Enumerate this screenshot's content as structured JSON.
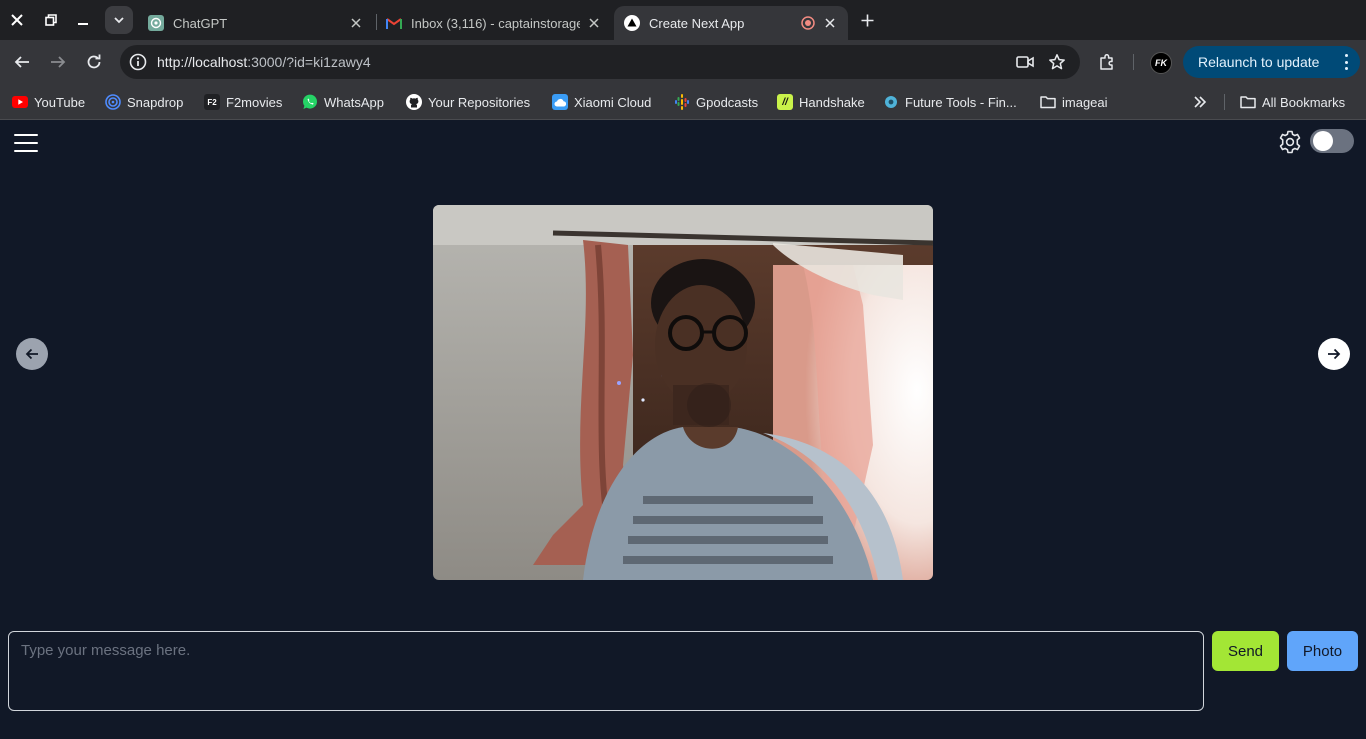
{
  "tabs": [
    {
      "title": "ChatGPT",
      "icon": "chatgpt-icon",
      "active": false
    },
    {
      "title": "Inbox (3,116) - captainstorage",
      "icon": "gmail-icon",
      "active": false
    },
    {
      "title": "Create Next App",
      "icon": "nextjs-icon",
      "active": true,
      "recording": true
    }
  ],
  "toolbar": {
    "url_host": "http://localhost",
    "url_rest": ":3000/?id=ki1zawy4",
    "profile_initials": "FK",
    "relaunch_label": "Relaunch to update"
  },
  "bookmarks": [
    {
      "label": "YouTube",
      "icon": "youtube-icon",
      "color": "#ff0000"
    },
    {
      "label": "Snapdrop",
      "icon": "snapdrop-icon",
      "color": "#4f8cff"
    },
    {
      "label": "F2movies",
      "icon": "f2movies-icon",
      "color": "#ffffff"
    },
    {
      "label": "WhatsApp",
      "icon": "whatsapp-icon",
      "color": "#25d366"
    },
    {
      "label": "Your Repositories",
      "icon": "github-icon",
      "color": "#ffffff"
    },
    {
      "label": "Xiaomi Cloud",
      "icon": "xiaomi-cloud-icon",
      "color": "#3a9cf5"
    },
    {
      "label": "Gpodcasts",
      "icon": "google-podcasts-icon",
      "color": "#fbbc04"
    },
    {
      "label": "Handshake",
      "icon": "handshake-icon",
      "color": "#c9f24a"
    },
    {
      "label": "Future Tools - Fin...",
      "icon": "future-tools-icon",
      "color": "#4fb3d9"
    },
    {
      "label": "imageai",
      "icon": "folder-icon",
      "color": "#e8eaed"
    }
  ],
  "all_bookmarks_label": "All Bookmarks",
  "app": {
    "message_placeholder": "Type your message here.",
    "send_label": "Send",
    "photo_label": "Photo",
    "theme_toggle_on": false
  },
  "colors": {
    "app_bg": "#111827",
    "send_bg": "#a3e635",
    "photo_bg": "#60a5fa",
    "relaunch_bg": "#004a77"
  }
}
